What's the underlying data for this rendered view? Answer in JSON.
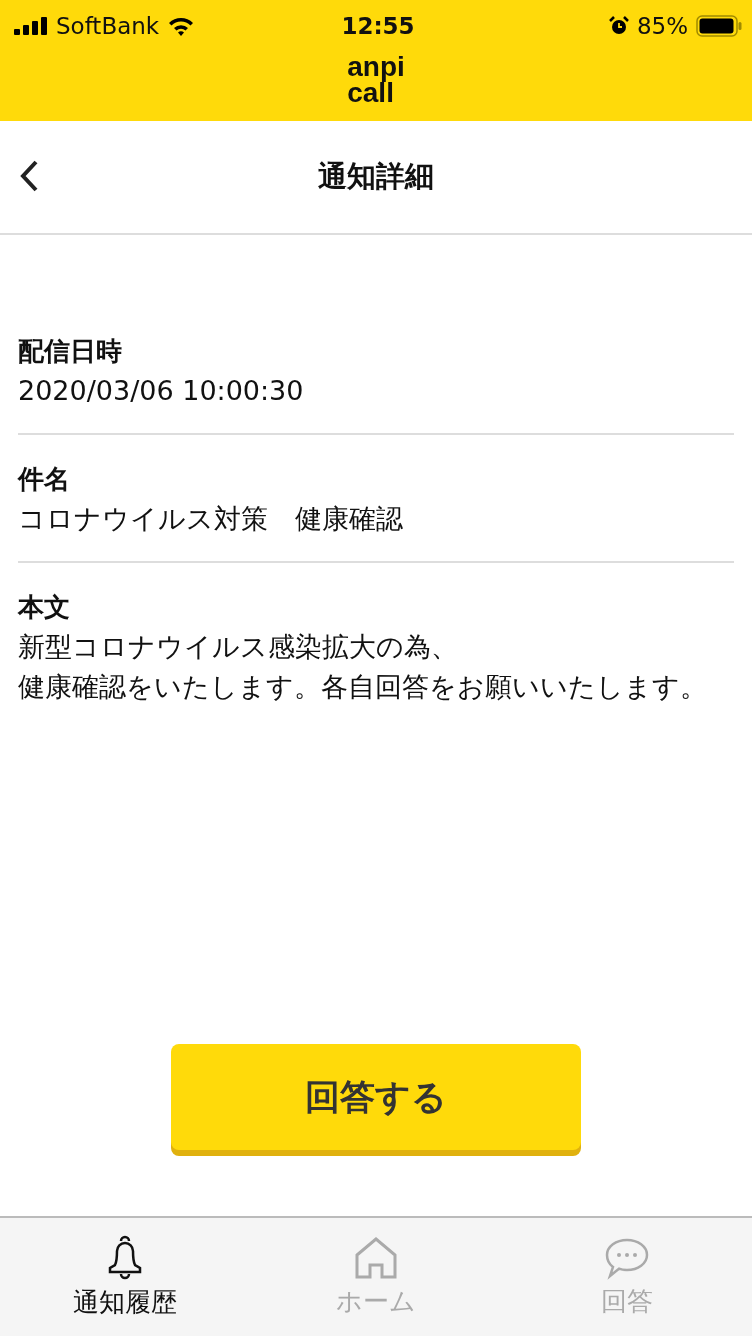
{
  "status_bar": {
    "carrier": "SoftBank",
    "time": "12:55",
    "battery": "85%"
  },
  "logo": {
    "line_1": "anpi",
    "line_2": "call"
  },
  "nav": {
    "title": "通知詳細"
  },
  "fields": [
    {
      "label": "配信日時",
      "lines": [
        "2020/03/06 10:00:30"
      ]
    },
    {
      "label": "件名",
      "lines": [
        "コロナウイルス対策　健康確認"
      ]
    },
    {
      "label": "本文",
      "lines": [
        "新型コロナウイルス感染拡大の為、",
        "健康確認をいたします。各自回答をお願いいたします。"
      ]
    }
  ],
  "answer_button": "回答する",
  "tabs": [
    {
      "label": "通知履歴",
      "kind": "bell",
      "selected": true
    },
    {
      "label": "ホーム",
      "kind": "home",
      "selected": false
    },
    {
      "label": "回答",
      "kind": "chat",
      "selected": false
    }
  ]
}
